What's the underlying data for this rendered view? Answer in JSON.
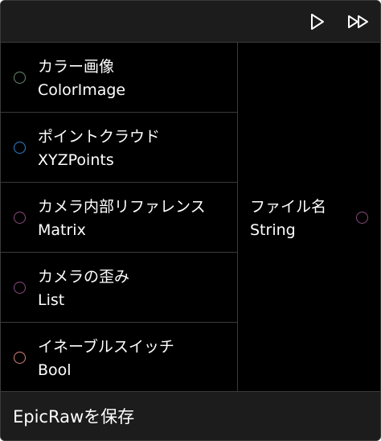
{
  "toolbar": {
    "play_icon": "play-icon",
    "fast_forward_icon": "fast-forward-icon"
  },
  "inputs": [
    {
      "name": "カラー画像",
      "type": "ColorImage",
      "color": "#6b8a70"
    },
    {
      "name": "ポイントクラウド",
      "type": "XYZPoints",
      "color": "#2f7fd0"
    },
    {
      "name": "カメラ内部リファレンス",
      "type": "Matrix",
      "color": "#8a4a80"
    },
    {
      "name": "カメラの歪み",
      "type": "List",
      "color": "#8a4a80"
    },
    {
      "name": "イネーブルスイッチ",
      "type": "Bool",
      "color": "#d4847a"
    }
  ],
  "output": {
    "name": "ファイル名",
    "type": "String",
    "color": "#8a4a80"
  },
  "footer": {
    "title": "EpicRawを保存"
  }
}
